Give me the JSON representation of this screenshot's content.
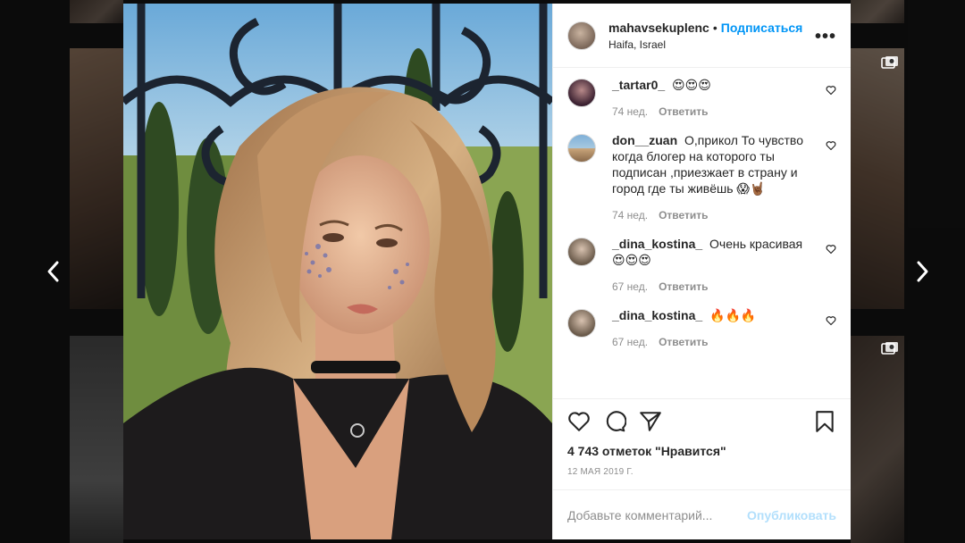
{
  "post": {
    "username": "mahavsekuplenc",
    "follow_label": "Подписаться",
    "location": "Haifa, Israel",
    "more_label": "•••",
    "likes_text": "4 743 отметок \"Нравится\"",
    "date": "12 МАЯ 2019 Г."
  },
  "comments": [
    {
      "user": "_tartar0_",
      "text": "😍😍😍",
      "age": "74 нед.",
      "reply": "Ответить"
    },
    {
      "user": "don__zuan",
      "text": "О,прикол То чувство когда блогер на которого ты подписан ,приезжает в страну и город где ты живёшь 😱🤘🏾",
      "age": "74 нед.",
      "reply": "Ответить"
    },
    {
      "user": "_dina_kostina_",
      "text": "Очень красивая😍😍😍",
      "age": "67 нед.",
      "reply": "Ответить"
    },
    {
      "user": "_dina_kostina_",
      "text": "🔥🔥🔥",
      "age": "67 нед.",
      "reply": "Ответить"
    }
  ],
  "comment_box": {
    "placeholder": "Добавьте комментарий...",
    "publish_label": "Опубликовать"
  },
  "colors": {
    "accent": "#0095f6",
    "publish_disabled": "#b2dffc",
    "muted": "#8e8e8e",
    "text": "#262626"
  }
}
